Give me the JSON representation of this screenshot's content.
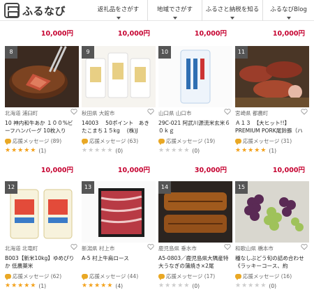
{
  "header": {
    "logo": "ふるなび",
    "nav": [
      {
        "label": "返礼品をさがす"
      },
      {
        "label": "地域でさがす"
      },
      {
        "label": "ふるさと納税を知る"
      },
      {
        "label": "ふるなびBlog"
      }
    ]
  },
  "top_prices": [
    "10,000円",
    "10,000円",
    "10,000円",
    "10,000円"
  ],
  "row1_prices": [
    "10,000円",
    "10,000円",
    "30,000円",
    "10,000円"
  ],
  "products": [
    {
      "rank": "8",
      "location": "北海道 浦臼町",
      "title": "10 神内和牛あか １００%ビーフハンバーグ 10枚入り",
      "message": "応援メッセージ (89)",
      "rating": 5,
      "review_count": "(1)"
    },
    {
      "rank": "9",
      "location": "秋田県 大館市",
      "title": "14003　 50ポイント　あきたこまち１５kg　 (株)J",
      "message": "応援メッセージ (63)",
      "rating": 0,
      "review_count": "(0)"
    },
    {
      "rank": "10",
      "location": "山口県 山口市",
      "title": "29C-021 阿武川源流米玄米６０ｋｇ",
      "message": "応援メッセージ (19)",
      "rating": 0,
      "review_count": "(0)"
    },
    {
      "rank": "11",
      "location": "宮崎県 都農町",
      "title": "Ａ１３　【大ヒット!!】PREMIUM PORK尾鈴豚（ハ",
      "message": "応援メッセージ (31)",
      "rating": 5,
      "review_count": "(1)"
    },
    {
      "rank": "12",
      "location": "北海道 北竜町",
      "title": "B003【新米10kg】ゆめぴりか 低農薬米",
      "message": "応援メッセージ (62)",
      "rating": 5,
      "review_count": "(1)"
    },
    {
      "rank": "13",
      "location": "新潟県 村上市",
      "title": "A-5 村上牛肩ロース",
      "message": "応援メッセージ (44)",
      "rating": 4.5,
      "review_count": "(4)"
    },
    {
      "rank": "14",
      "location": "鹿児島県 垂水市",
      "title": "A5-0803／鹿児島県大隅産特大うなぎの蒲焼き×2尾",
      "message": "応援メッセージ (17)",
      "rating": 0,
      "review_count": "(0)"
    },
    {
      "rank": "15",
      "location": "和歌山県 橋本市",
      "title": "種なしぶどう旬の詰め合わせ《ラッキーコース、約",
      "message": "応援メッセージ (16)",
      "rating": 0,
      "review_count": "(0)"
    }
  ],
  "colors": {
    "price": "#c5002f",
    "star_on": "#f3a11b",
    "star_off": "#cccccc",
    "rank_bg": "#555555"
  }
}
